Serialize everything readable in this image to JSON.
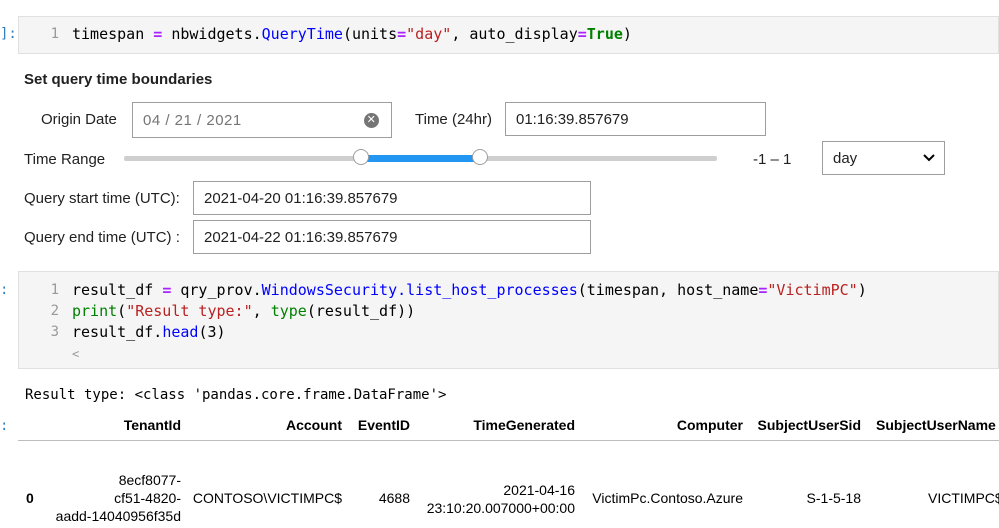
{
  "cell1": {
    "prompt": "]:",
    "line_no": "1",
    "code": {
      "p1": "timespan ",
      "eq": "=",
      "p2": " nbwidgets.",
      "fn": "QueryTime",
      "p3": "(units",
      "eq2": "=",
      "str": "\"day\"",
      "p4": ", auto_display",
      "eq3": "=",
      "kw": "True",
      "p5": ")"
    }
  },
  "widget": {
    "title": "Set query time boundaries",
    "origin_date_label": "Origin Date",
    "origin_date_value": "04 / 21 / 2021",
    "time_label": "Time (24hr)",
    "time_value": "01:16:39.857679",
    "time_range_label": "Time Range",
    "range_readout": "-1 – 1",
    "range_low": -1,
    "range_high": 1,
    "range_min": -5,
    "range_max": 5,
    "units_selected": "day",
    "start_label": "Query start time (UTC):",
    "start_value": "2021-04-20 01:16:39.857679",
    "end_label": "Query end time (UTC) :",
    "end_value": "2021-04-22 01:16:39.857679",
    "accent": "#2196f3"
  },
  "cell2": {
    "prompt": ":",
    "lines": [
      {
        "no": "1",
        "a": "result_df ",
        "eq": "=",
        "b": " qry_prov.",
        "fn": "WindowsSecurity.list_host_processes",
        "c": "(timespan, host_name",
        "eq2": "=",
        "str": "\"VictimPC\"",
        "d": ")"
      },
      {
        "no": "2",
        "kw": "print",
        "a": "(",
        "str": "\"Result type:\"",
        "b": ", ",
        "kw2": "type",
        "c": "(result_df))"
      },
      {
        "no": "3",
        "a": "result_df.",
        "fn": "head",
        "b": "(3)"
      }
    ],
    "scroll_left": "<"
  },
  "output": {
    "text": "Result type: <class 'pandas.core.frame.DataFrame'>",
    "prompt": ":",
    "columns": [
      "TenantId",
      "Account",
      "EventID",
      "TimeGenerated",
      "Computer",
      "SubjectUserSid",
      "SubjectUserName"
    ],
    "row": {
      "index": "0",
      "tenant": [
        "8ecf8077-",
        "cf51-4820-",
        "aadd-14040956f35d"
      ],
      "account": "CONTOSO\\VICTIMPC$",
      "eventid": "4688",
      "time": [
        "2021-04-16",
        "23:10:20.007000+00:00"
      ],
      "computer": "VictimPc.Contoso.Azure",
      "sid": "S-1-5-18",
      "username": "VICTIMPC$"
    }
  }
}
